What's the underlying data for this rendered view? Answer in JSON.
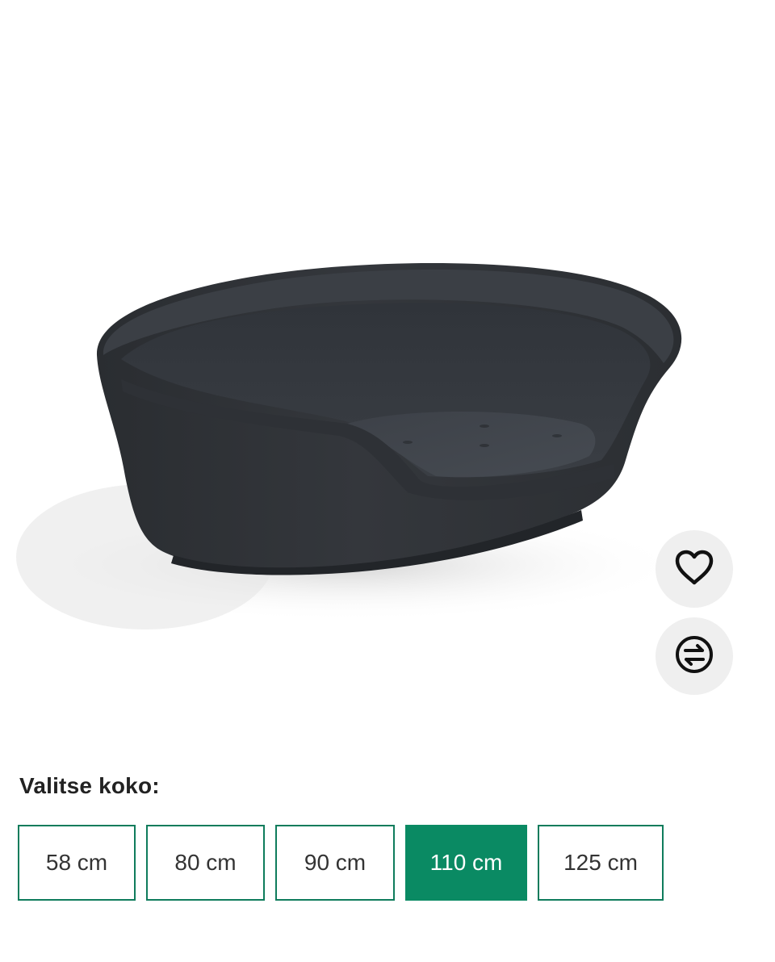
{
  "product": {
    "image_alt": "Dark grey plastic oval dog bed"
  },
  "actions": {
    "wishlist_icon": "heart-icon",
    "compare_icon": "compare-arrows-icon"
  },
  "size_selector": {
    "label": "Valitse koko:",
    "options": [
      {
        "label": "58 cm",
        "selected": false
      },
      {
        "label": "80 cm",
        "selected": false
      },
      {
        "label": "90 cm",
        "selected": false
      },
      {
        "label": "110 cm",
        "selected": true
      },
      {
        "label": "125 cm",
        "selected": false
      }
    ]
  },
  "colors": {
    "accent": "#0a8a63",
    "border": "#0f7c5c",
    "button_bg": "#efefef"
  }
}
